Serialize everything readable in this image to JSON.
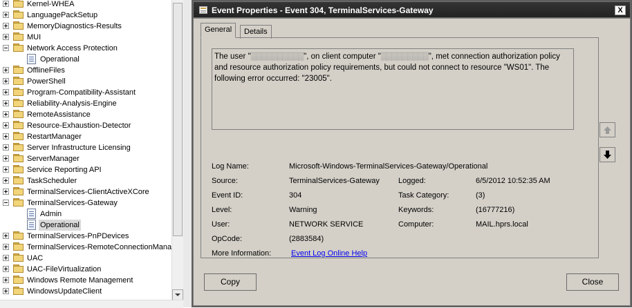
{
  "tree": {
    "items": [
      {
        "label": "Kernel-WHEA",
        "expander": "plus",
        "icon": "folder"
      },
      {
        "label": "LanguagePackSetup",
        "expander": "plus",
        "icon": "folder"
      },
      {
        "label": "MemoryDiagnostics-Results",
        "expander": "plus",
        "icon": "folder"
      },
      {
        "label": "MUI",
        "expander": "plus",
        "icon": "folder"
      },
      {
        "label": "Network Access Protection",
        "expander": "minus",
        "icon": "folder"
      },
      {
        "label": "Operational",
        "expander": "none",
        "icon": "log",
        "indent": true
      },
      {
        "label": "OfflineFiles",
        "expander": "plus",
        "icon": "folder"
      },
      {
        "label": "PowerShell",
        "expander": "plus",
        "icon": "folder"
      },
      {
        "label": "Program-Compatibility-Assistant",
        "expander": "plus",
        "icon": "folder"
      },
      {
        "label": "Reliability-Analysis-Engine",
        "expander": "plus",
        "icon": "folder"
      },
      {
        "label": "RemoteAssistance",
        "expander": "plus",
        "icon": "folder"
      },
      {
        "label": "Resource-Exhaustion-Detector",
        "expander": "plus",
        "icon": "folder"
      },
      {
        "label": "RestartManager",
        "expander": "plus",
        "icon": "folder"
      },
      {
        "label": "Server Infrastructure Licensing",
        "expander": "plus",
        "icon": "folder"
      },
      {
        "label": "ServerManager",
        "expander": "plus",
        "icon": "folder"
      },
      {
        "label": "Service Reporting API",
        "expander": "plus",
        "icon": "folder"
      },
      {
        "label": "TaskScheduler",
        "expander": "plus",
        "icon": "folder"
      },
      {
        "label": "TerminalServices-ClientActiveXCore",
        "expander": "plus",
        "icon": "folder"
      },
      {
        "label": "TerminalServices-Gateway",
        "expander": "minus",
        "icon": "folder"
      },
      {
        "label": "Admin",
        "expander": "none",
        "icon": "log",
        "indent": true
      },
      {
        "label": "Operational",
        "expander": "none",
        "icon": "log",
        "indent": true,
        "selected": true
      },
      {
        "label": "TerminalServices-PnPDevices",
        "expander": "plus",
        "icon": "folder"
      },
      {
        "label": "TerminalServices-RemoteConnectionManag",
        "expander": "plus",
        "icon": "folder"
      },
      {
        "label": "UAC",
        "expander": "plus",
        "icon": "folder"
      },
      {
        "label": "UAC-FileVirtualization",
        "expander": "plus",
        "icon": "folder"
      },
      {
        "label": "Windows Remote Management",
        "expander": "plus",
        "icon": "folder"
      },
      {
        "label": "WindowsUpdateClient",
        "expander": "plus",
        "icon": "folder"
      }
    ]
  },
  "dialog": {
    "title": "Event Properties - Event 304, TerminalServices-Gateway",
    "close_glyph": "X",
    "tabs": [
      "General",
      "Details"
    ],
    "active_tab": "General",
    "description": {
      "part1": "The user \"",
      "masked_user": "▒▒▒▒▒▒▒▒▒▒",
      "part2": "\", on client computer \"",
      "masked_computer": "▒▒▒▒▒▒▒▒▒",
      "part3": "\", met connection authorization policy and resource authorization policy requirements, but could not connect to resource \"WS01\". The following error occurred: \"23005\"."
    },
    "fields": {
      "log_name_label": "Log Name:",
      "log_name": "Microsoft-Windows-TerminalServices-Gateway/Operational",
      "source_label": "Source:",
      "source": "TerminalServices-Gateway",
      "logged_label": "Logged:",
      "logged": "6/5/2012 10:52:35 AM",
      "event_id_label": "Event ID:",
      "event_id": "304",
      "task_category_label": "Task Category:",
      "task_category": "(3)",
      "level_label": "Level:",
      "level": "Warning",
      "keywords_label": "Keywords:",
      "keywords": "(16777216)",
      "user_label": "User:",
      "user": "NETWORK SERVICE",
      "computer_label": "Computer:",
      "computer": "MAIL.hprs.local",
      "opcode_label": "OpCode:",
      "opcode": "(2883584)",
      "more_info_label": "More Information:",
      "more_info_link": "Event Log Online Help"
    },
    "buttons": {
      "copy": "Copy",
      "close": "Close"
    },
    "colors": {
      "face": "#d4d0c8",
      "titlebar": "#2b2b2b",
      "link": "#0000ee"
    }
  }
}
